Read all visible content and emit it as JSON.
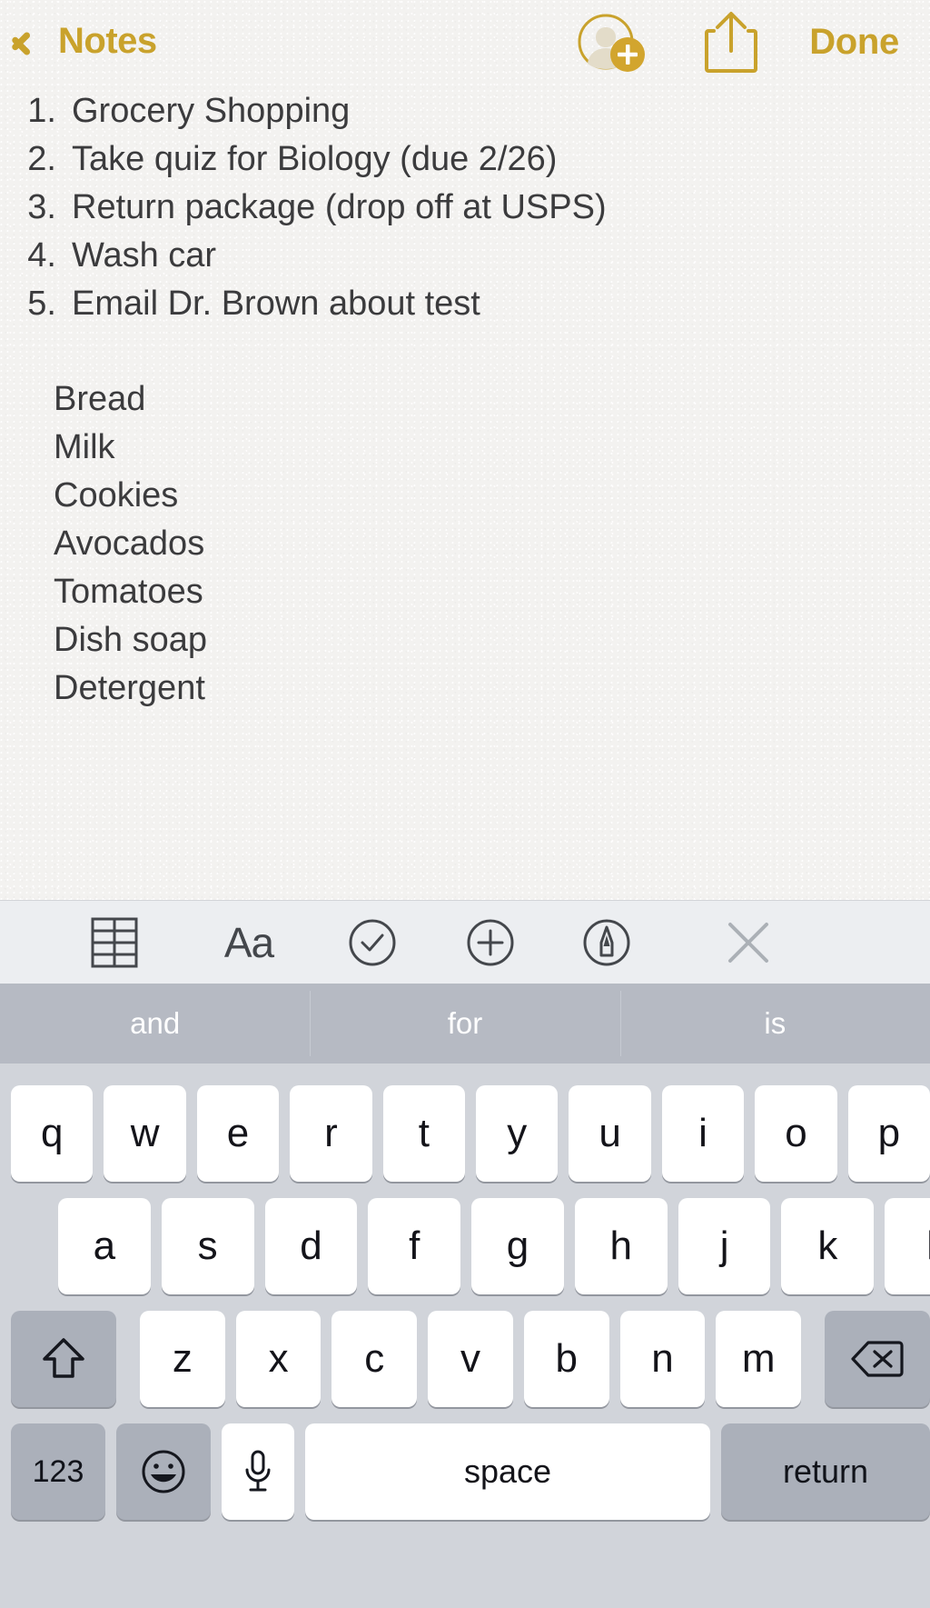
{
  "navbar": {
    "back_label": "Notes",
    "back_icon": "chevron-left-icon",
    "add_person_icon": "add-person-icon",
    "share_icon": "share-icon",
    "done_label": "Done",
    "accent_color": "#c9a22c"
  },
  "note": {
    "ordered_items": [
      {
        "num": "1.",
        "text": "Grocery Shopping"
      },
      {
        "num": "2.",
        "text": "Take quiz for Biology (due 2/26)"
      },
      {
        "num": "3.",
        "text": "Return package (drop off at USPS)"
      },
      {
        "num": "4.",
        "text": "Wash car"
      },
      {
        "num": "5.",
        "text": "Email Dr. Brown about test"
      }
    ],
    "plain_lines": [
      "Bread",
      "Milk",
      "Cookies",
      "Avocados",
      "Tomatoes",
      "Dish soap",
      "Detergent"
    ],
    "text_color": "#3b3b3d",
    "paper_color": "#f3f2f0"
  },
  "format_toolbar": {
    "background": "#eceef1",
    "items": [
      {
        "name": "table-icon",
        "label": ""
      },
      {
        "name": "text-format-icon",
        "label": "Aa"
      },
      {
        "name": "checklist-icon",
        "label": ""
      },
      {
        "name": "add-attachment-icon",
        "label": ""
      },
      {
        "name": "markup-pen-icon",
        "label": ""
      },
      {
        "name": "close-icon",
        "label": ""
      }
    ]
  },
  "keyboard": {
    "background": "#d1d4da",
    "predictions_background": "#b6bac3",
    "predictions": [
      "and",
      "for",
      "is"
    ],
    "row1": [
      "q",
      "w",
      "e",
      "r",
      "t",
      "y",
      "u",
      "i",
      "o",
      "p"
    ],
    "row2": [
      "a",
      "s",
      "d",
      "f",
      "g",
      "h",
      "j",
      "k",
      "l"
    ],
    "row3": [
      "z",
      "x",
      "c",
      "v",
      "b",
      "n",
      "m"
    ],
    "shift_icon": "shift-icon",
    "delete_icon": "delete-icon",
    "numbers_label": "123",
    "emoji_icon": "emoji-icon",
    "dictation_icon": "microphone-icon",
    "space_label": "space",
    "return_label": "return"
  }
}
